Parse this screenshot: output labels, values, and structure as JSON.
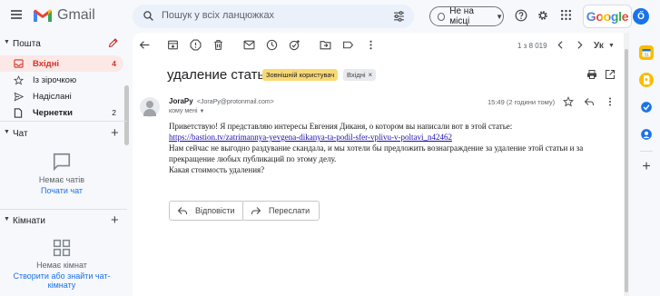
{
  "topbar": {
    "app_name": "Gmail",
    "search_placeholder": "Пошук у всіх ланцюжках",
    "status_label": "Не на місці",
    "google_label": "Google",
    "avatar_letter": "Ő",
    "colors": {
      "avatar": "#1a73e8"
    }
  },
  "nav": {
    "mail_section": "Пошта",
    "items": [
      {
        "label": "Вхідні",
        "count": "4",
        "icon": "inbox-icon",
        "active": true
      },
      {
        "label": "Із зірочкою",
        "count": "",
        "icon": "star-icon"
      },
      {
        "label": "Надіслані",
        "count": "",
        "icon": "send-icon"
      },
      {
        "label": "Чернетки",
        "count": "2",
        "icon": "draft-icon"
      }
    ],
    "chat_section": "Чат",
    "chat_empty": "Немає чатів",
    "chat_link": "Почати чат",
    "rooms_section": "Кімнати",
    "rooms_empty": "Немає кімнат",
    "rooms_link": "Створити або знайти чат-кімнату"
  },
  "toolbar": {
    "pager": "1 з 8 019",
    "input_tool": "Ук"
  },
  "message": {
    "subject": "удаление статьи",
    "external_badge": "Зовнішній користувач",
    "inbox_badge": "Вхідні",
    "sender_name": "JoraPy",
    "sender_email": "<JoraPy@protonmail.com>",
    "to_me": "кому мені",
    "time": "15:49 (2 години тому)",
    "body": {
      "line1": "Приветствую! Я представляю интересы Евгения Диканя, о котором вы написали вот в этой статье:",
      "link": "https://bastion.tv/zatrimannya-yevgena-dikanya-ta-podil-sfer-vplivu-v-poltavi_n42462",
      "line2": "Нам сейчас не выгодно раздувание скандала, и мы хотели бы предложить вознаграждение за удаление этой статьи и за",
      "line3": "прекращение любых публикаций по этому делу.",
      "line4": "Какая стоимость удаления?"
    },
    "reply_label": "Відповісти",
    "forward_label": "Переслати"
  }
}
